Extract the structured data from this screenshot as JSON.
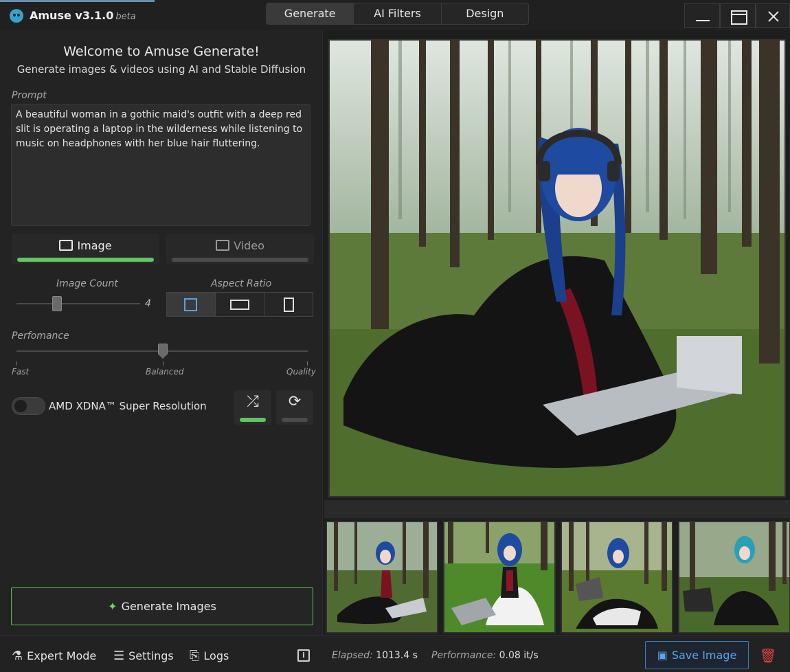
{
  "app": {
    "title": "Amuse v3.1.0",
    "badge": "beta"
  },
  "tabs": [
    "Generate",
    "AI Filters",
    "Design"
  ],
  "welcome": {
    "title": "Welcome to Amuse Generate!",
    "subtitle": "Generate images & videos using AI and Stable Diffusion"
  },
  "prompt": {
    "label": "Prompt",
    "value": "A beautiful woman in a gothic maid's outfit with a deep red slit is operating a laptop in the wilderness while listening to music on headphones with her blue hair fluttering."
  },
  "modes": {
    "image": "Image",
    "video": "Video"
  },
  "image_count": {
    "label": "Image Count",
    "value": "4"
  },
  "aspect_ratio": {
    "label": "Aspect Ratio",
    "options": [
      "square",
      "landscape",
      "portrait"
    ],
    "selected": "square"
  },
  "performance": {
    "label": "Perfomance",
    "fast": "Fast",
    "balanced": "Balanced",
    "quality": "Quality",
    "level": 0.5
  },
  "super_resolution": {
    "label": "AMD XDNA™ Super Resolution",
    "enabled": false
  },
  "generate_button": "Generate Images",
  "footer": {
    "expert_mode": "Expert Mode",
    "settings": "Settings",
    "logs": "Logs",
    "elapsed_label": "Elapsed:",
    "elapsed_value": "1013.4 s",
    "performance_label": "Performance:",
    "performance_value": "0.08 it/s",
    "save_button": "Save Image"
  },
  "colors": {
    "accent_green": "#62c462",
    "accent_blue": "#3a7dbd",
    "danger": "#e04040"
  }
}
